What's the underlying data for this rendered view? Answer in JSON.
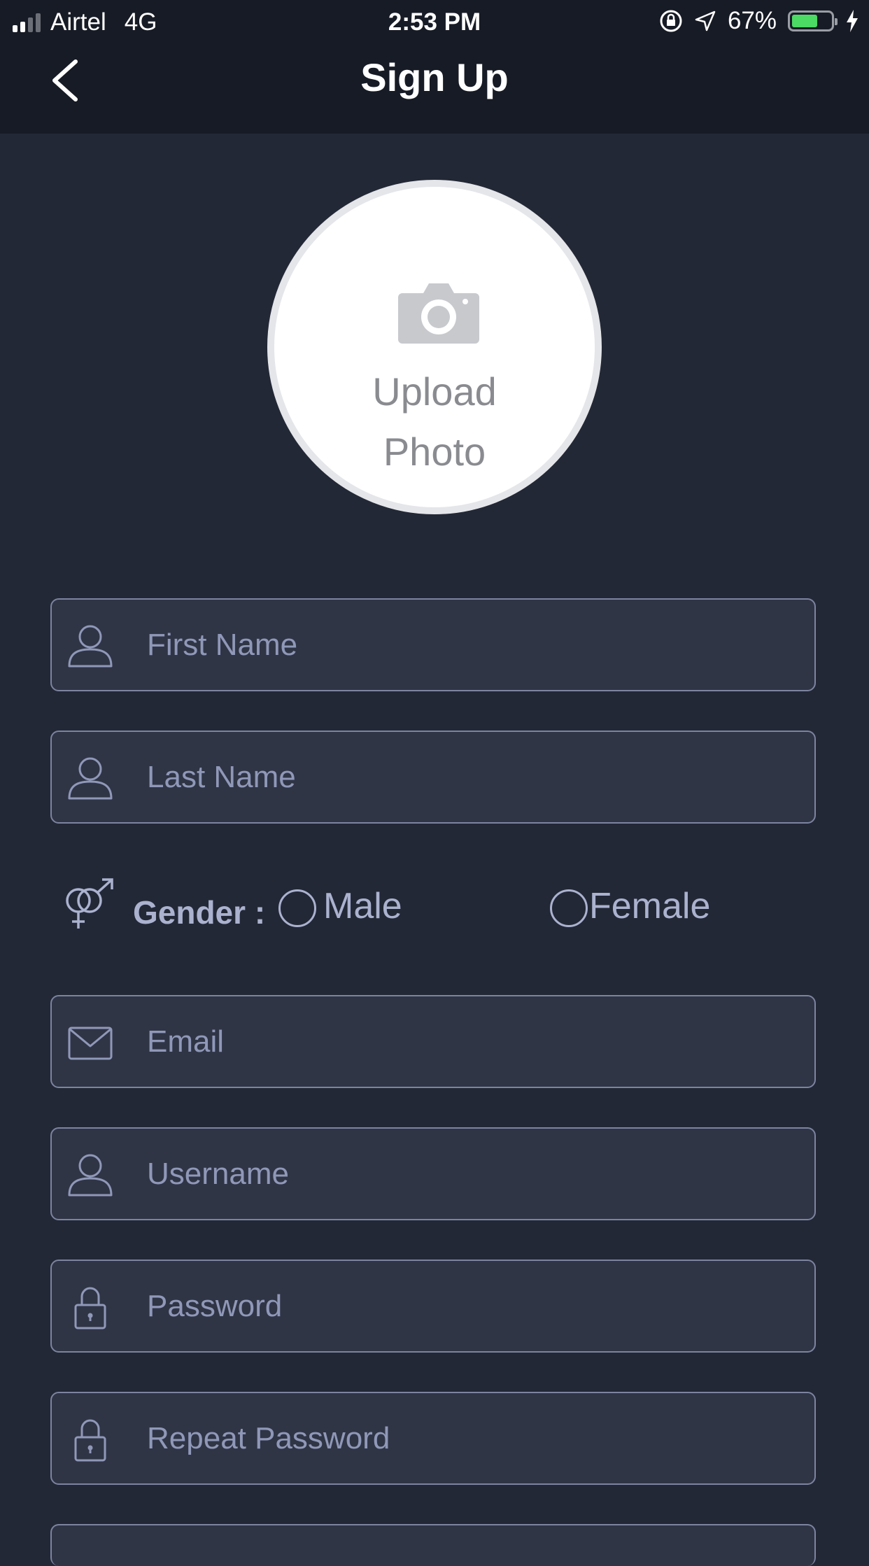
{
  "status_bar": {
    "carrier": "Airtel",
    "network": "4G",
    "time": "2:53 PM",
    "battery": "67%",
    "battery_level": 0.67
  },
  "header": {
    "title": "Sign Up"
  },
  "photo": {
    "line1": "Upload",
    "line2": "Photo"
  },
  "fields": {
    "first_name": {
      "placeholder": "First Name",
      "value": ""
    },
    "last_name": {
      "placeholder": "Last Name",
      "value": ""
    },
    "email": {
      "placeholder": "Email",
      "value": ""
    },
    "username": {
      "placeholder": "Username",
      "value": ""
    },
    "password": {
      "placeholder": "Password",
      "value": ""
    },
    "repeat_password": {
      "placeholder": "Repeat Password",
      "value": ""
    }
  },
  "gender": {
    "label": "Gender :",
    "options": [
      "Male",
      "Female"
    ],
    "selected": null
  },
  "colors": {
    "background": "#232836",
    "header": "#171b25",
    "field_bg": "#303546",
    "field_border": "#7c84a0",
    "placeholder": "#8f98b8",
    "accent_text": "#aab2cf",
    "battery": "#4cd964"
  },
  "icons": [
    "back-chevron-icon",
    "camera-icon",
    "user-icon",
    "gender-icon",
    "mail-icon",
    "lock-icon"
  ]
}
